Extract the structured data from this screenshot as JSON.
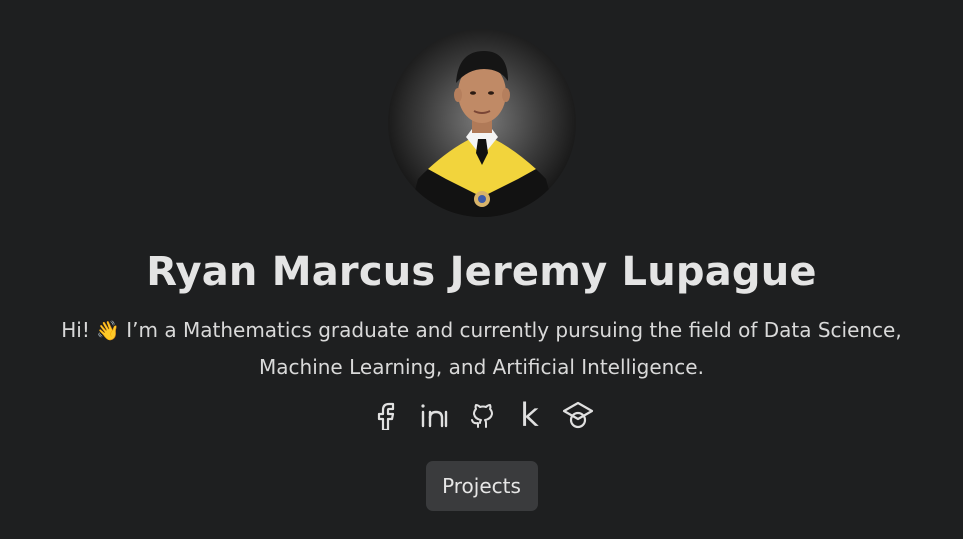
{
  "profile": {
    "name": "Ryan Marcus Jeremy Lupague",
    "bio_line1_pre": "Hi! ",
    "bio_emoji": "👋",
    "bio_line1_post": " I’m a Mathematics graduate and currently pursuing the field of Data Science,",
    "bio_line2": "Machine Learning, and Artificial Intelligence."
  },
  "socials": [
    {
      "icon": "facebook-icon"
    },
    {
      "icon": "linkedin-icon"
    },
    {
      "icon": "github-icon"
    },
    {
      "icon": "kaggle-icon",
      "glyph": "k"
    },
    {
      "icon": "graduation-cap-icon"
    }
  ],
  "actions": {
    "projects_label": "Projects"
  },
  "colors": {
    "background": "#1e1f20",
    "text": "#e4e4e4",
    "button_bg": "#3a3b3d",
    "gown_stole": "#f2d43c"
  }
}
